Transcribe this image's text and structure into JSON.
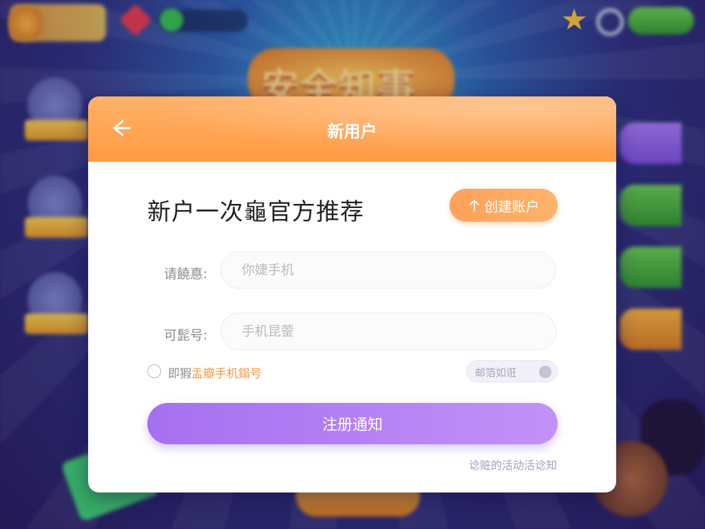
{
  "background": {
    "banner_text": "安全知事"
  },
  "dialog": {
    "title": "新用户",
    "headline": "新户一次龜官方推荐",
    "create_button_label": "创建账户",
    "fields": [
      {
        "label": "请饒惪:",
        "placeholder": "你婕手机",
        "value": ""
      },
      {
        "label": "可髭号:",
        "placeholder": "手机昆蓥",
        "value": ""
      }
    ],
    "agreement": {
      "prefix": "即猳",
      "link_text": "盂瓣手机鎉号",
      "checked": false
    },
    "email_pill_text": "邮箔如诳",
    "submit_label": "注册通知",
    "footer_link": "谂赃的活动活谂知"
  },
  "colors": {
    "header": "#ff9a42",
    "primary_button": "#a66ff0",
    "accent_link": "#f29a4a"
  }
}
